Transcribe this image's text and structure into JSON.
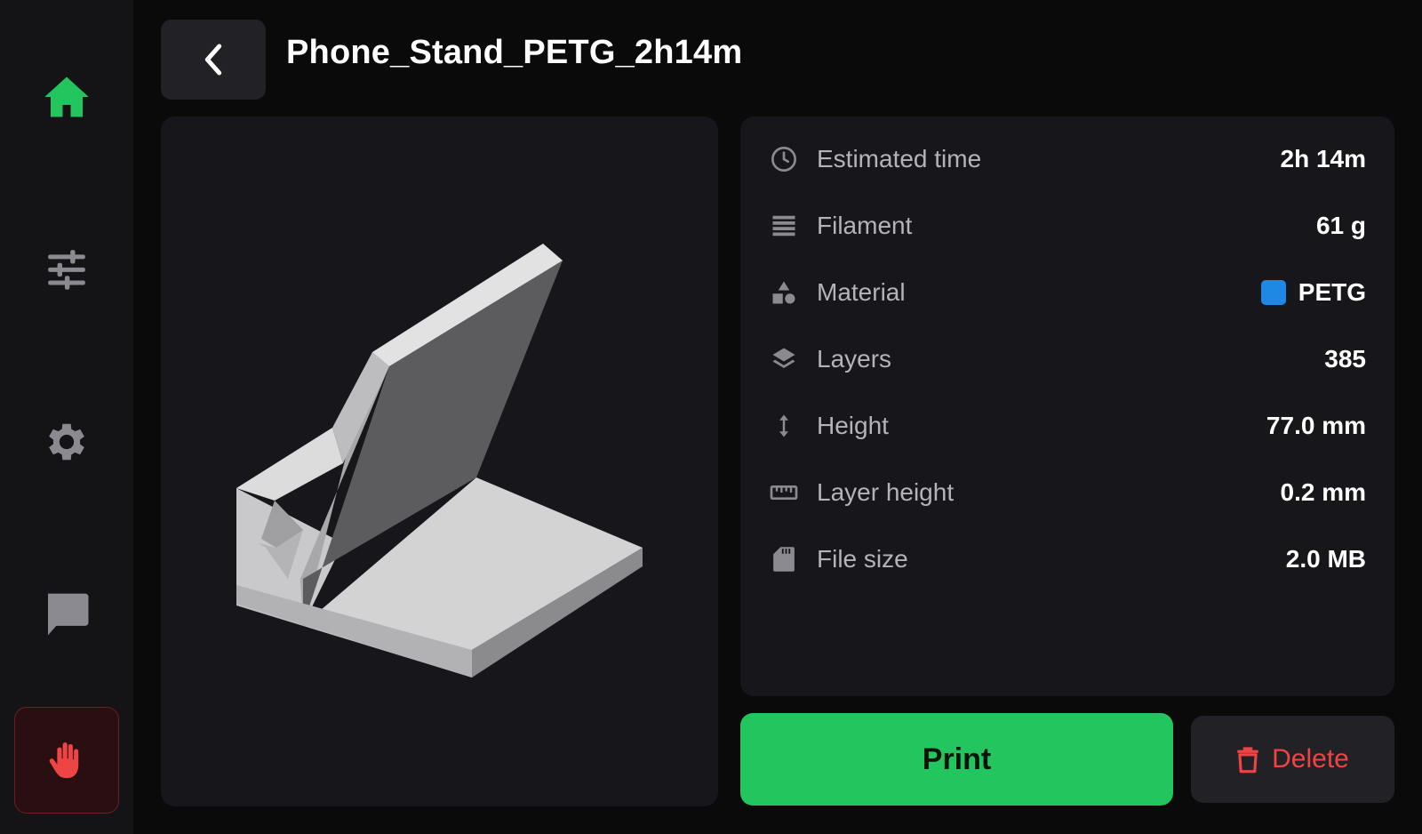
{
  "header": {
    "title": "Phone_Stand_PETG_2h14m"
  },
  "sidebar": {
    "items": [
      {
        "name": "home",
        "icon": "home-icon",
        "active": true
      },
      {
        "name": "tune",
        "icon": "sliders-icon"
      },
      {
        "name": "settings",
        "icon": "gear-icon"
      },
      {
        "name": "console",
        "icon": "chat-icon"
      }
    ],
    "emergency_stop": {
      "icon": "hand-stop-icon"
    }
  },
  "file_info": {
    "rows": [
      {
        "icon": "clock-icon",
        "label": "Estimated time",
        "value": "2h 14m"
      },
      {
        "icon": "filament-icon",
        "label": "Filament",
        "value": "61 g"
      },
      {
        "icon": "shapes-icon",
        "label": "Material",
        "value": "PETG",
        "swatch": "#1e88e5"
      },
      {
        "icon": "layers-icon",
        "label": "Layers",
        "value": "385"
      },
      {
        "icon": "height-icon",
        "label": "Height",
        "value": "77.0 mm"
      },
      {
        "icon": "ruler-icon",
        "label": "Layer height",
        "value": "0.2 mm"
      },
      {
        "icon": "sd-card-icon",
        "label": "File size",
        "value": "2.0 MB"
      }
    ]
  },
  "actions": {
    "print_label": "Print",
    "delete_label": "Delete"
  },
  "colors": {
    "accent": "#22c55e",
    "danger": "#ef4444",
    "material_swatch": "#1e88e5",
    "panel": "#17171b",
    "sidebar": "#141416",
    "background": "#0a0a0b"
  }
}
